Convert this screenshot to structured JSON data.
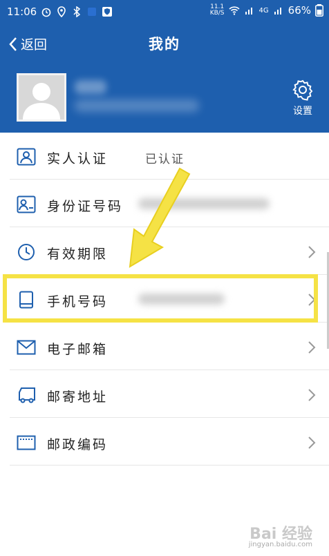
{
  "status": {
    "time": "11:06",
    "speed_top": "11.1",
    "speed_bottom": "KB/S",
    "network": "4G",
    "battery": "66%"
  },
  "header": {
    "back_label": "返回",
    "title": "我的"
  },
  "profile": {
    "settings_label": "设置"
  },
  "menu": [
    {
      "label": "实人认证",
      "value": "已认证",
      "icon": "person-id-icon",
      "chevron": false
    },
    {
      "label": "身份证号码",
      "value": "",
      "icon": "id-card-icon",
      "chevron": false
    },
    {
      "label": "有效期限",
      "value": "",
      "icon": "clock-icon",
      "chevron": true
    },
    {
      "label": "手机号码",
      "value": "",
      "icon": "phone-icon",
      "chevron": true
    },
    {
      "label": "电子邮箱",
      "value": "",
      "icon": "mail-icon",
      "chevron": true
    },
    {
      "label": "邮寄地址",
      "value": "",
      "icon": "truck-icon",
      "chevron": true
    },
    {
      "label": "邮政编码",
      "value": "",
      "icon": "postcode-icon",
      "chevron": true
    }
  ],
  "watermark": {
    "text": "Bai 经验",
    "sub": "jingyan.baidu.com"
  },
  "colors": {
    "brand_blue": "#1e5fae",
    "highlight_yellow": "#f5e245"
  }
}
